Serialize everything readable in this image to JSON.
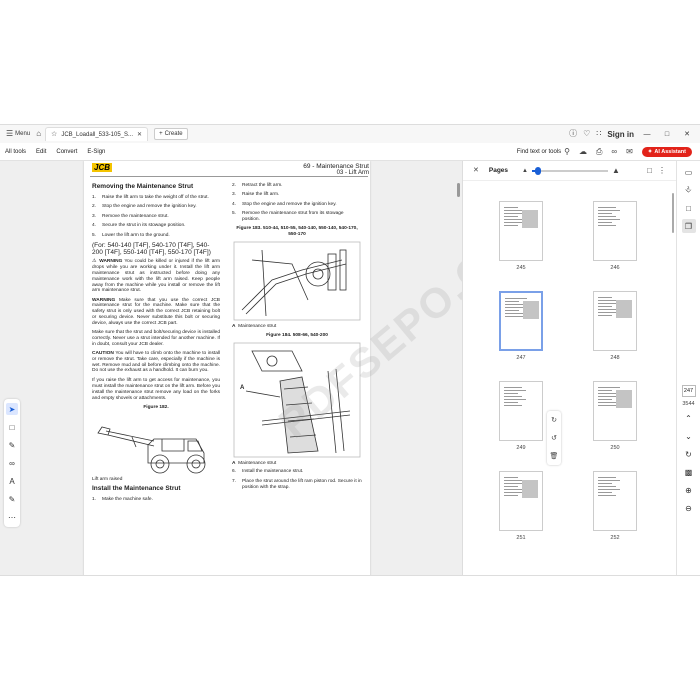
{
  "titlebar": {
    "menu_label": "Menu",
    "tab_title": "JCB_Loadall_533-105_S...",
    "create_label": "Create",
    "signin_label": "Sign in"
  },
  "toolbar": {
    "items": [
      "All tools",
      "Edit",
      "Convert",
      "E-Sign"
    ],
    "find_label": "Find text or tools",
    "ai_label": "AI Assistant"
  },
  "document": {
    "logo": "JCB",
    "header_line1": "69 - Maintenance Strut",
    "header_line2": "03 - Lift Arm",
    "section1_title": "Removing the Maintenance Strut",
    "section1_steps": [
      "Raise the lift arm to take the weight off of the strut.",
      "Stop the engine and remove the ignition key.",
      "Remove the maintenance strut.",
      "Secure the strut in its stowage position.",
      "Lower the lift arm to the ground."
    ],
    "for_heading": "(For: 540-140 [T4F], 540-170 [T4F], 540-200 [T4F], 550-140 [T4F], 550-170 [T4F])",
    "warning1_label": "WARNING",
    "warning1_text": "You could be killed or injured if the lift arm drops while you are working under it. Install the lift arm maintenance strut as instructed before doing any maintenance work with the lift arm raised. Keep people away from the machine while you install or remove the lift arm maintenance strut.",
    "warning2_label": "WARNING",
    "warning2_text": "Make sure that you use the correct JCB maintenance strut for the machine. Make sure that the safety strut is only used with the correct JCB retaining bolt or securing device. Never substitute this bolt or securing device, always use the correct JCB part.",
    "note_text": "Make sure that the strut and bolt/securing device is installed correctly. Never use a strut intended for another machine. If in doubt, consult your JCB dealer.",
    "caution_label": "CAUTION",
    "caution_text": "You will have to climb onto the machine to install or remove the strut. Take care, especially if the machine is wet. Remove mud and oil before climbing onto the machine. Do not use the exhaust as a handhold. It can burn you.",
    "intro_text": "If you raise the lift arm to get access for maintenance, you must install the maintenance strut on the lift arm. Before you install the maintenance strut remove any load on the forks and empty shovels or attachments.",
    "fig182_caption": "Figure 182.",
    "fig182_label": "Lift arm raised",
    "section2_title": "Install the Maintenance Strut",
    "section2_steps": [
      "Make the machine safe."
    ],
    "col2_steps": [
      "Retract the lift arm.",
      "Raise the lift arm.",
      "Stop the engine and remove the ignition key.",
      "Remove the maintenance strut from its stowage position."
    ],
    "fig183_caption": "Figure 183. 510-44, 510-55, 540-140, 550-140, 540-170, 550-170",
    "fig183_label_letter": "A",
    "fig183_label": "Maintenance strut",
    "fig184_caption": "Figure 184. 508-66, 540-200",
    "fig184_label_letter": "A",
    "fig184_label": "Maintenance strut",
    "col2_more_steps": [
      "Install the maintenance strut.",
      "Place the strut around the lift ram piston rod. Secure it in position with the strap."
    ],
    "callout_a": "A",
    "watermark": "PDFSEPO.COM"
  },
  "pages_panel": {
    "title": "Pages",
    "zoom_fraction": 0.08,
    "thumbnails": [
      "245",
      "246",
      "247",
      "248",
      "249",
      "250",
      "251",
      "252"
    ],
    "selected": "247"
  },
  "rail": {
    "current_page": "247",
    "total_pages": "3544"
  },
  "colors": {
    "accent": "#1a5fd6",
    "ai_button": "#e2231a",
    "logo_bg": "#f4c400"
  }
}
